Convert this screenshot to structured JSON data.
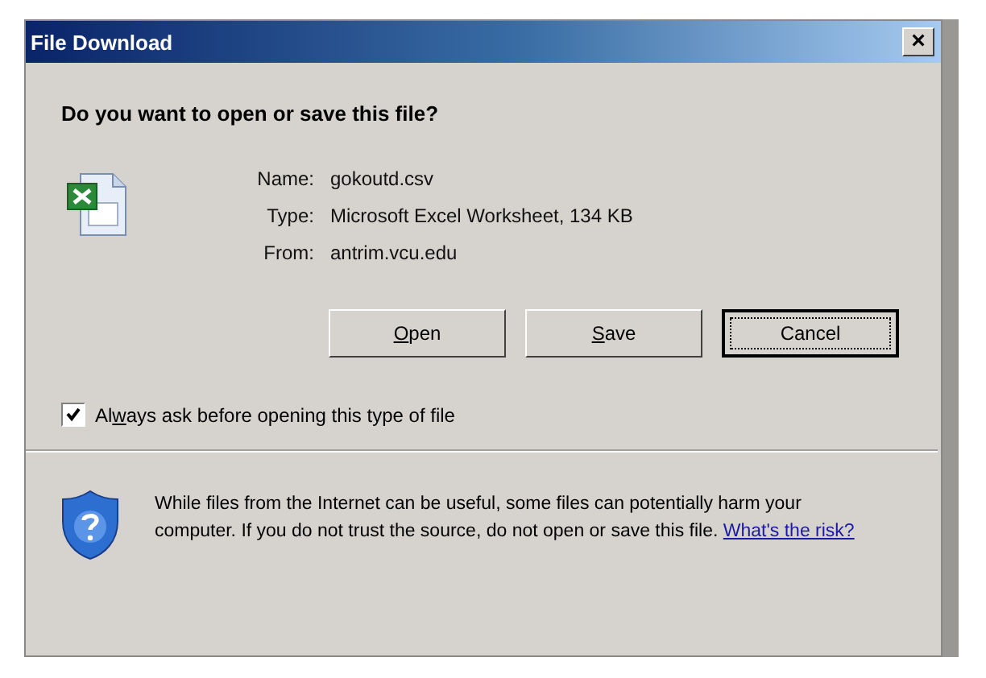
{
  "window": {
    "title": "File Download",
    "close": "×"
  },
  "question": "Do you want to open or save this file?",
  "file": [
    {
      "label": "Name:",
      "value": "gokoutd.csv"
    },
    {
      "label": "Type:",
      "value": "Microsoft Excel Worksheet, 134 KB"
    },
    {
      "label": "From:",
      "value": "antrim.vcu.edu"
    }
  ],
  "buttons": [
    {
      "parts": [
        {
          "text": "O",
          "underline": true
        },
        {
          "text": "pen",
          "underline": false
        }
      ],
      "default": false
    },
    {
      "parts": [
        {
          "text": "S",
          "underline": true
        },
        {
          "text": "ave",
          "underline": false
        }
      ],
      "default": false
    },
    {
      "parts": [
        {
          "text": "Cancel",
          "underline": false
        }
      ],
      "default": true
    }
  ],
  "always_ask": {
    "checked": true,
    "parts": [
      {
        "text": "Al",
        "underline": false
      },
      {
        "text": "w",
        "underline": true
      },
      {
        "text": "ays ask before opening this type of file",
        "underline": false
      }
    ]
  },
  "warning": {
    "text": "While files from the Internet can be useful, some files can potentially harm your computer. If you do not trust the source, do not open or save this file.",
    "link": "What's the risk?"
  }
}
